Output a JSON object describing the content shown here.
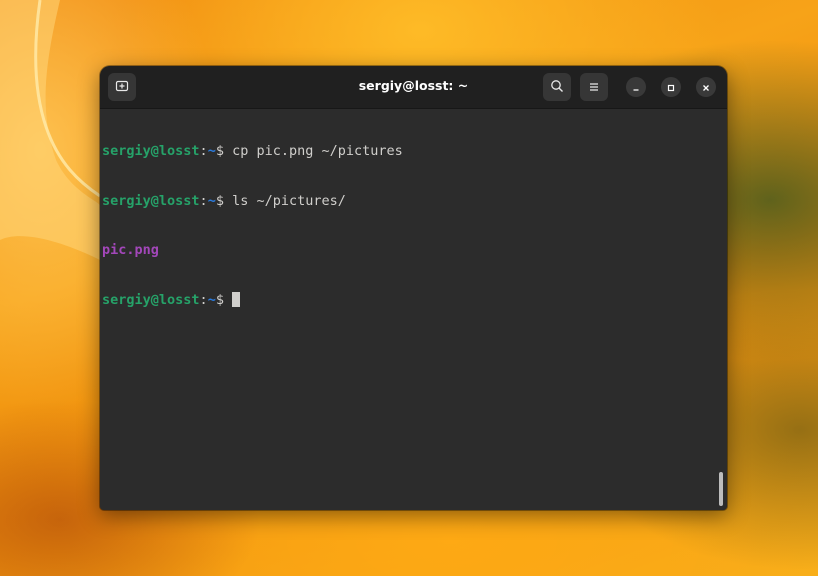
{
  "window": {
    "title": "sergiy@losst: ~"
  },
  "headerbar": {
    "new_tab_icon": "new-tab-icon",
    "search_icon": "search-icon",
    "menu_icon": "hamburger-menu-icon",
    "minimize_icon": "minimize-icon",
    "maximize_icon": "maximize-icon",
    "close_icon": "close-icon"
  },
  "terminal": {
    "lines": [
      {
        "user": "sergiy@losst",
        "sep": ":",
        "path": "~",
        "symbol": "$",
        "command": " cp pic.png ~/pictures"
      },
      {
        "user": "sergiy@losst",
        "sep": ":",
        "path": "~",
        "symbol": "$",
        "command": " ls ~/pictures/"
      },
      {
        "output": "pic.png"
      },
      {
        "user": "sergiy@losst",
        "sep": ":",
        "path": "~",
        "symbol": "$",
        "command": " "
      }
    ],
    "colors": {
      "background": "#2c2c2c",
      "text": "#d0cfcc",
      "user": "#26a269",
      "path": "#2a7bde",
      "file": "#a347ba"
    }
  }
}
